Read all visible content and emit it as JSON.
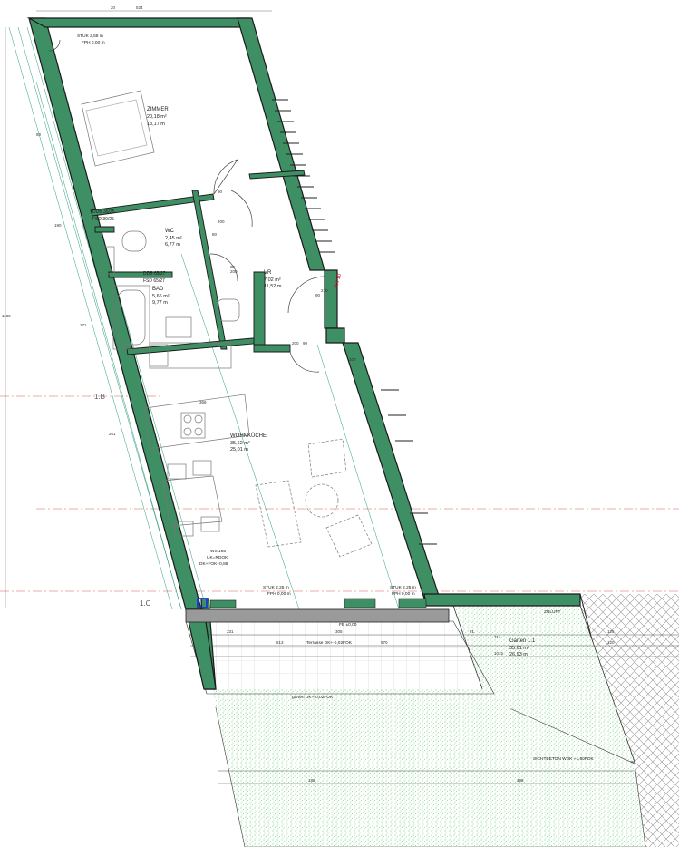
{
  "rooms": {
    "zimmer": {
      "name": "ZIMMER",
      "area": "20,18 m²",
      "perimeter": "18,17 m"
    },
    "wc": {
      "name": "WC",
      "area": "2,45 m²",
      "perimeter": "6,77 m"
    },
    "bad": {
      "name": "BAD",
      "area": "5,66 m²",
      "perimeter": "9,77 m"
    },
    "vr": {
      "name": "VR",
      "area": "7,02 m²",
      "perimeter": "11,52 m"
    },
    "wohnkueche": {
      "name": "WOHNKÜCHE",
      "area": "35,62 m²",
      "perimeter": "25,01 m"
    },
    "garten": {
      "name": "Garten 1.1",
      "area": "35,61 m²",
      "perimeter": "26,93 m"
    }
  },
  "openings": {
    "ddb_wc": "DDB 35/25",
    "fsd_wc": "FSD 30/25",
    "ddb_bad": "DDB 65/27",
    "fsd_bad": "FSD 65/27"
  },
  "annotations": {
    "stuk_top": "STUK 2,58 m",
    "fph_top": "FPH 0,00 m",
    "stuk_bl": "STUK 2,25 m",
    "fph_bl": "FPH 0,00 m",
    "stuk_br": "STUK 2,25 m",
    "fph_br": "FPH 0,00 m",
    "ws_line1": "WS 165",
    "ws_line2": "UK=RDOK",
    "ws_line3": "DK+FOK+0,88",
    "zuluft": "ZULUFT",
    "terrasse": "Terrasse DK+-0,02FOK",
    "garten_level": "garten DK+-0,02FOK",
    "sichtbeton": "SICHTBETON WDK +1,60FOK",
    "red_label": "FH 10",
    "fb_label": "FB ±0,00"
  },
  "axes": {
    "b": "1.B",
    "c": "1.C"
  },
  "dimensions": {
    "top_width": "534",
    "top_small": "20",
    "door_zimmer": "90",
    "door_zimmer2": "200",
    "door_wc": "80",
    "door_wc2": "200",
    "door_bad": "80",
    "door_bad2": "200",
    "door_vr": "90",
    "door_vr2": "200",
    "door_entry": "90",
    "door_entry2": "210",
    "kitchen_width": "366",
    "vr_inner": "100",
    "terrace_a": "231",
    "terrace_b": "305",
    "terrace_c": "613",
    "terrace_d": "970",
    "terrace_e": "21",
    "terrace_f": "314",
    "terrace_g": "125",
    "terrace_h": "120",
    "terrace_i": "1015",
    "garden_a": "185",
    "garden_b": "398",
    "left_a": "1180",
    "left_b": "80",
    "left_c": "190",
    "left_d": "171",
    "left_e": "201"
  },
  "colors": {
    "wall_fill": "#3f8f64",
    "wall_outline": "#1a1a1a",
    "garden_dots": "#4cc860",
    "ground_hatch": "#9a9a9a",
    "axis_line": "#e89090",
    "dim_line": "#2a9e7a",
    "marker_blue": "#1030e0"
  }
}
